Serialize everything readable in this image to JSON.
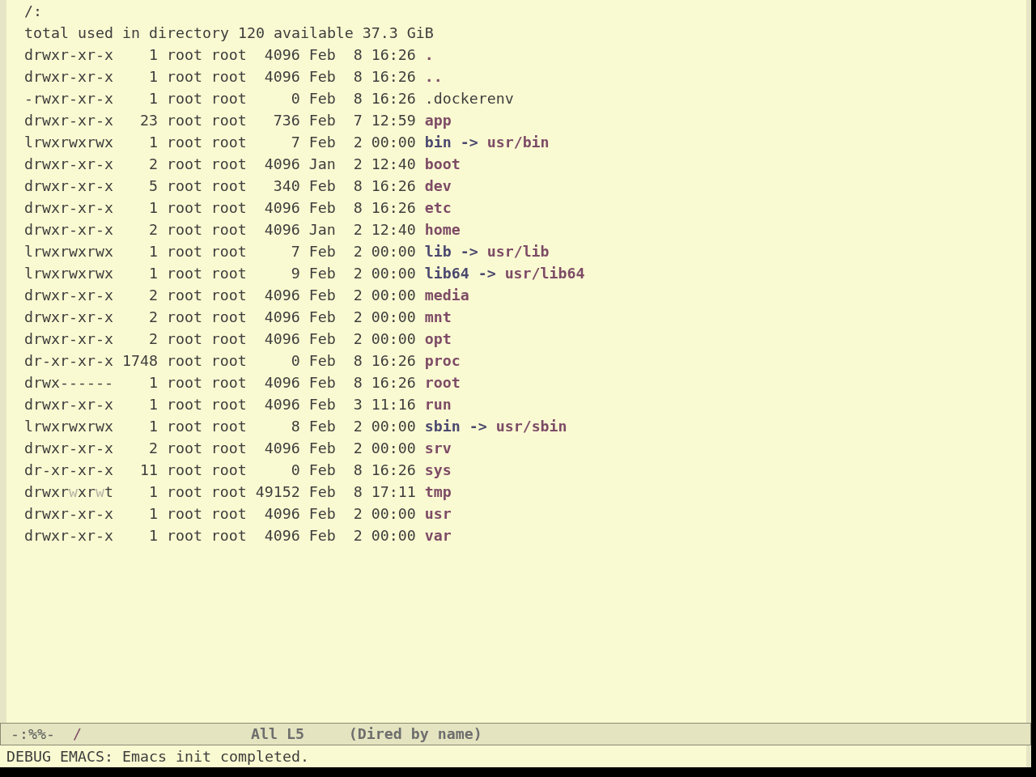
{
  "buffer": {
    "header": "/:",
    "summary": "total used in directory 120 available 37.3 GiB",
    "entries": [
      {
        "permissions": "drwxr-xr-x",
        "links": "1",
        "owner": "root",
        "group": "root",
        "size": "4096",
        "month": "Feb",
        "day": "8",
        "time": "16:26",
        "name": ".",
        "kind": "directory"
      },
      {
        "permissions": "drwxr-xr-x",
        "links": "1",
        "owner": "root",
        "group": "root",
        "size": "4096",
        "month": "Feb",
        "day": "8",
        "time": "16:26",
        "name": "..",
        "kind": "directory"
      },
      {
        "permissions": "-rwxr-xr-x",
        "links": "1",
        "owner": "root",
        "group": "root",
        "size": "0",
        "month": "Feb",
        "day": "8",
        "time": "16:26",
        "name": ".dockerenv",
        "kind": "file"
      },
      {
        "permissions": "drwxr-xr-x",
        "links": "23",
        "owner": "root",
        "group": "root",
        "size": "736",
        "month": "Feb",
        "day": "7",
        "time": "12:59",
        "name": "app",
        "kind": "directory"
      },
      {
        "permissions": "lrwxrwxrwx",
        "links": "1",
        "owner": "root",
        "group": "root",
        "size": "7",
        "month": "Feb",
        "day": "2",
        "time": "00:00",
        "name": "bin",
        "kind": "symlink",
        "arrow": "->",
        "target": {
          "name": "usr/bin",
          "kind": "directory"
        }
      },
      {
        "permissions": "drwxr-xr-x",
        "links": "2",
        "owner": "root",
        "group": "root",
        "size": "4096",
        "month": "Jan",
        "day": "2",
        "time": "12:40",
        "name": "boot",
        "kind": "directory"
      },
      {
        "permissions": "drwxr-xr-x",
        "links": "5",
        "owner": "root",
        "group": "root",
        "size": "340",
        "month": "Feb",
        "day": "8",
        "time": "16:26",
        "name": "dev",
        "kind": "directory"
      },
      {
        "permissions": "drwxr-xr-x",
        "links": "1",
        "owner": "root",
        "group": "root",
        "size": "4096",
        "month": "Feb",
        "day": "8",
        "time": "16:26",
        "name": "etc",
        "kind": "directory"
      },
      {
        "permissions": "drwxr-xr-x",
        "links": "2",
        "owner": "root",
        "group": "root",
        "size": "4096",
        "month": "Jan",
        "day": "2",
        "time": "12:40",
        "name": "home",
        "kind": "directory"
      },
      {
        "permissions": "lrwxrwxrwx",
        "links": "1",
        "owner": "root",
        "group": "root",
        "size": "7",
        "month": "Feb",
        "day": "2",
        "time": "00:00",
        "name": "lib",
        "kind": "symlink",
        "arrow": "->",
        "target": {
          "name": "usr/lib",
          "kind": "directory"
        }
      },
      {
        "permissions": "lrwxrwxrwx",
        "links": "1",
        "owner": "root",
        "group": "root",
        "size": "9",
        "month": "Feb",
        "day": "2",
        "time": "00:00",
        "name": "lib64",
        "kind": "symlink",
        "arrow": "->",
        "target": {
          "name": "usr/lib64",
          "kind": "directory"
        }
      },
      {
        "permissions": "drwxr-xr-x",
        "links": "2",
        "owner": "root",
        "group": "root",
        "size": "4096",
        "month": "Feb",
        "day": "2",
        "time": "00:00",
        "name": "media",
        "kind": "directory"
      },
      {
        "permissions": "drwxr-xr-x",
        "links": "2",
        "owner": "root",
        "group": "root",
        "size": "4096",
        "month": "Feb",
        "day": "2",
        "time": "00:00",
        "name": "mnt",
        "kind": "directory"
      },
      {
        "permissions": "drwxr-xr-x",
        "links": "2",
        "owner": "root",
        "group": "root",
        "size": "4096",
        "month": "Feb",
        "day": "2",
        "time": "00:00",
        "name": "opt",
        "kind": "directory"
      },
      {
        "permissions": "dr-xr-xr-x",
        "links": "1748",
        "owner": "root",
        "group": "root",
        "size": "0",
        "month": "Feb",
        "day": "8",
        "time": "16:26",
        "name": "proc",
        "kind": "directory"
      },
      {
        "permissions": "drwx------",
        "links": "1",
        "owner": "root",
        "group": "root",
        "size": "4096",
        "month": "Feb",
        "day": "8",
        "time": "16:26",
        "name": "root",
        "kind": "directory"
      },
      {
        "permissions": "drwxr-xr-x",
        "links": "1",
        "owner": "root",
        "group": "root",
        "size": "4096",
        "month": "Feb",
        "day": "3",
        "time": "11:16",
        "name": "run",
        "kind": "directory"
      },
      {
        "permissions": "lrwxrwxrwx",
        "links": "1",
        "owner": "root",
        "group": "root",
        "size": "8",
        "month": "Feb",
        "day": "2",
        "time": "00:00",
        "name": "sbin",
        "kind": "symlink",
        "arrow": "->",
        "target": {
          "name": "usr/sbin",
          "kind": "directory"
        }
      },
      {
        "permissions": "drwxr-xr-x",
        "links": "2",
        "owner": "root",
        "group": "root",
        "size": "4096",
        "month": "Feb",
        "day": "2",
        "time": "00:00",
        "name": "srv",
        "kind": "directory"
      },
      {
        "permissions": "dr-xr-xr-x",
        "links": "11",
        "owner": "root",
        "group": "root",
        "size": "0",
        "month": "Feb",
        "day": "8",
        "time": "16:26",
        "name": "sys",
        "kind": "directory"
      },
      {
        "permissions": [
          {
            "text": "drwxr",
            "dim": false
          },
          {
            "text": "w",
            "dim": true
          },
          {
            "text": "xr",
            "dim": false
          },
          {
            "text": "w",
            "dim": true
          },
          {
            "text": "t",
            "dim": false
          }
        ],
        "links": "1",
        "owner": "root",
        "group": "root",
        "size": "49152",
        "month": "Feb",
        "day": "8",
        "time": "17:11",
        "name": "tmp",
        "kind": "directory"
      },
      {
        "permissions": "drwxr-xr-x",
        "links": "1",
        "owner": "root",
        "group": "root",
        "size": "4096",
        "month": "Feb",
        "day": "2",
        "time": "00:00",
        "name": "usr",
        "kind": "directory"
      },
      {
        "permissions": "drwxr-xr-x",
        "links": "1",
        "owner": "root",
        "group": "root",
        "size": "4096",
        "month": "Feb",
        "day": "2",
        "time": "00:00",
        "name": "var",
        "kind": "directory"
      }
    ]
  },
  "mode_line": {
    "status": "-:%%-",
    "buffer_name": "/",
    "position": "All L5",
    "mode": "(Dired by name)"
  },
  "echo_area": "DEBUG EMACS: Emacs init completed."
}
